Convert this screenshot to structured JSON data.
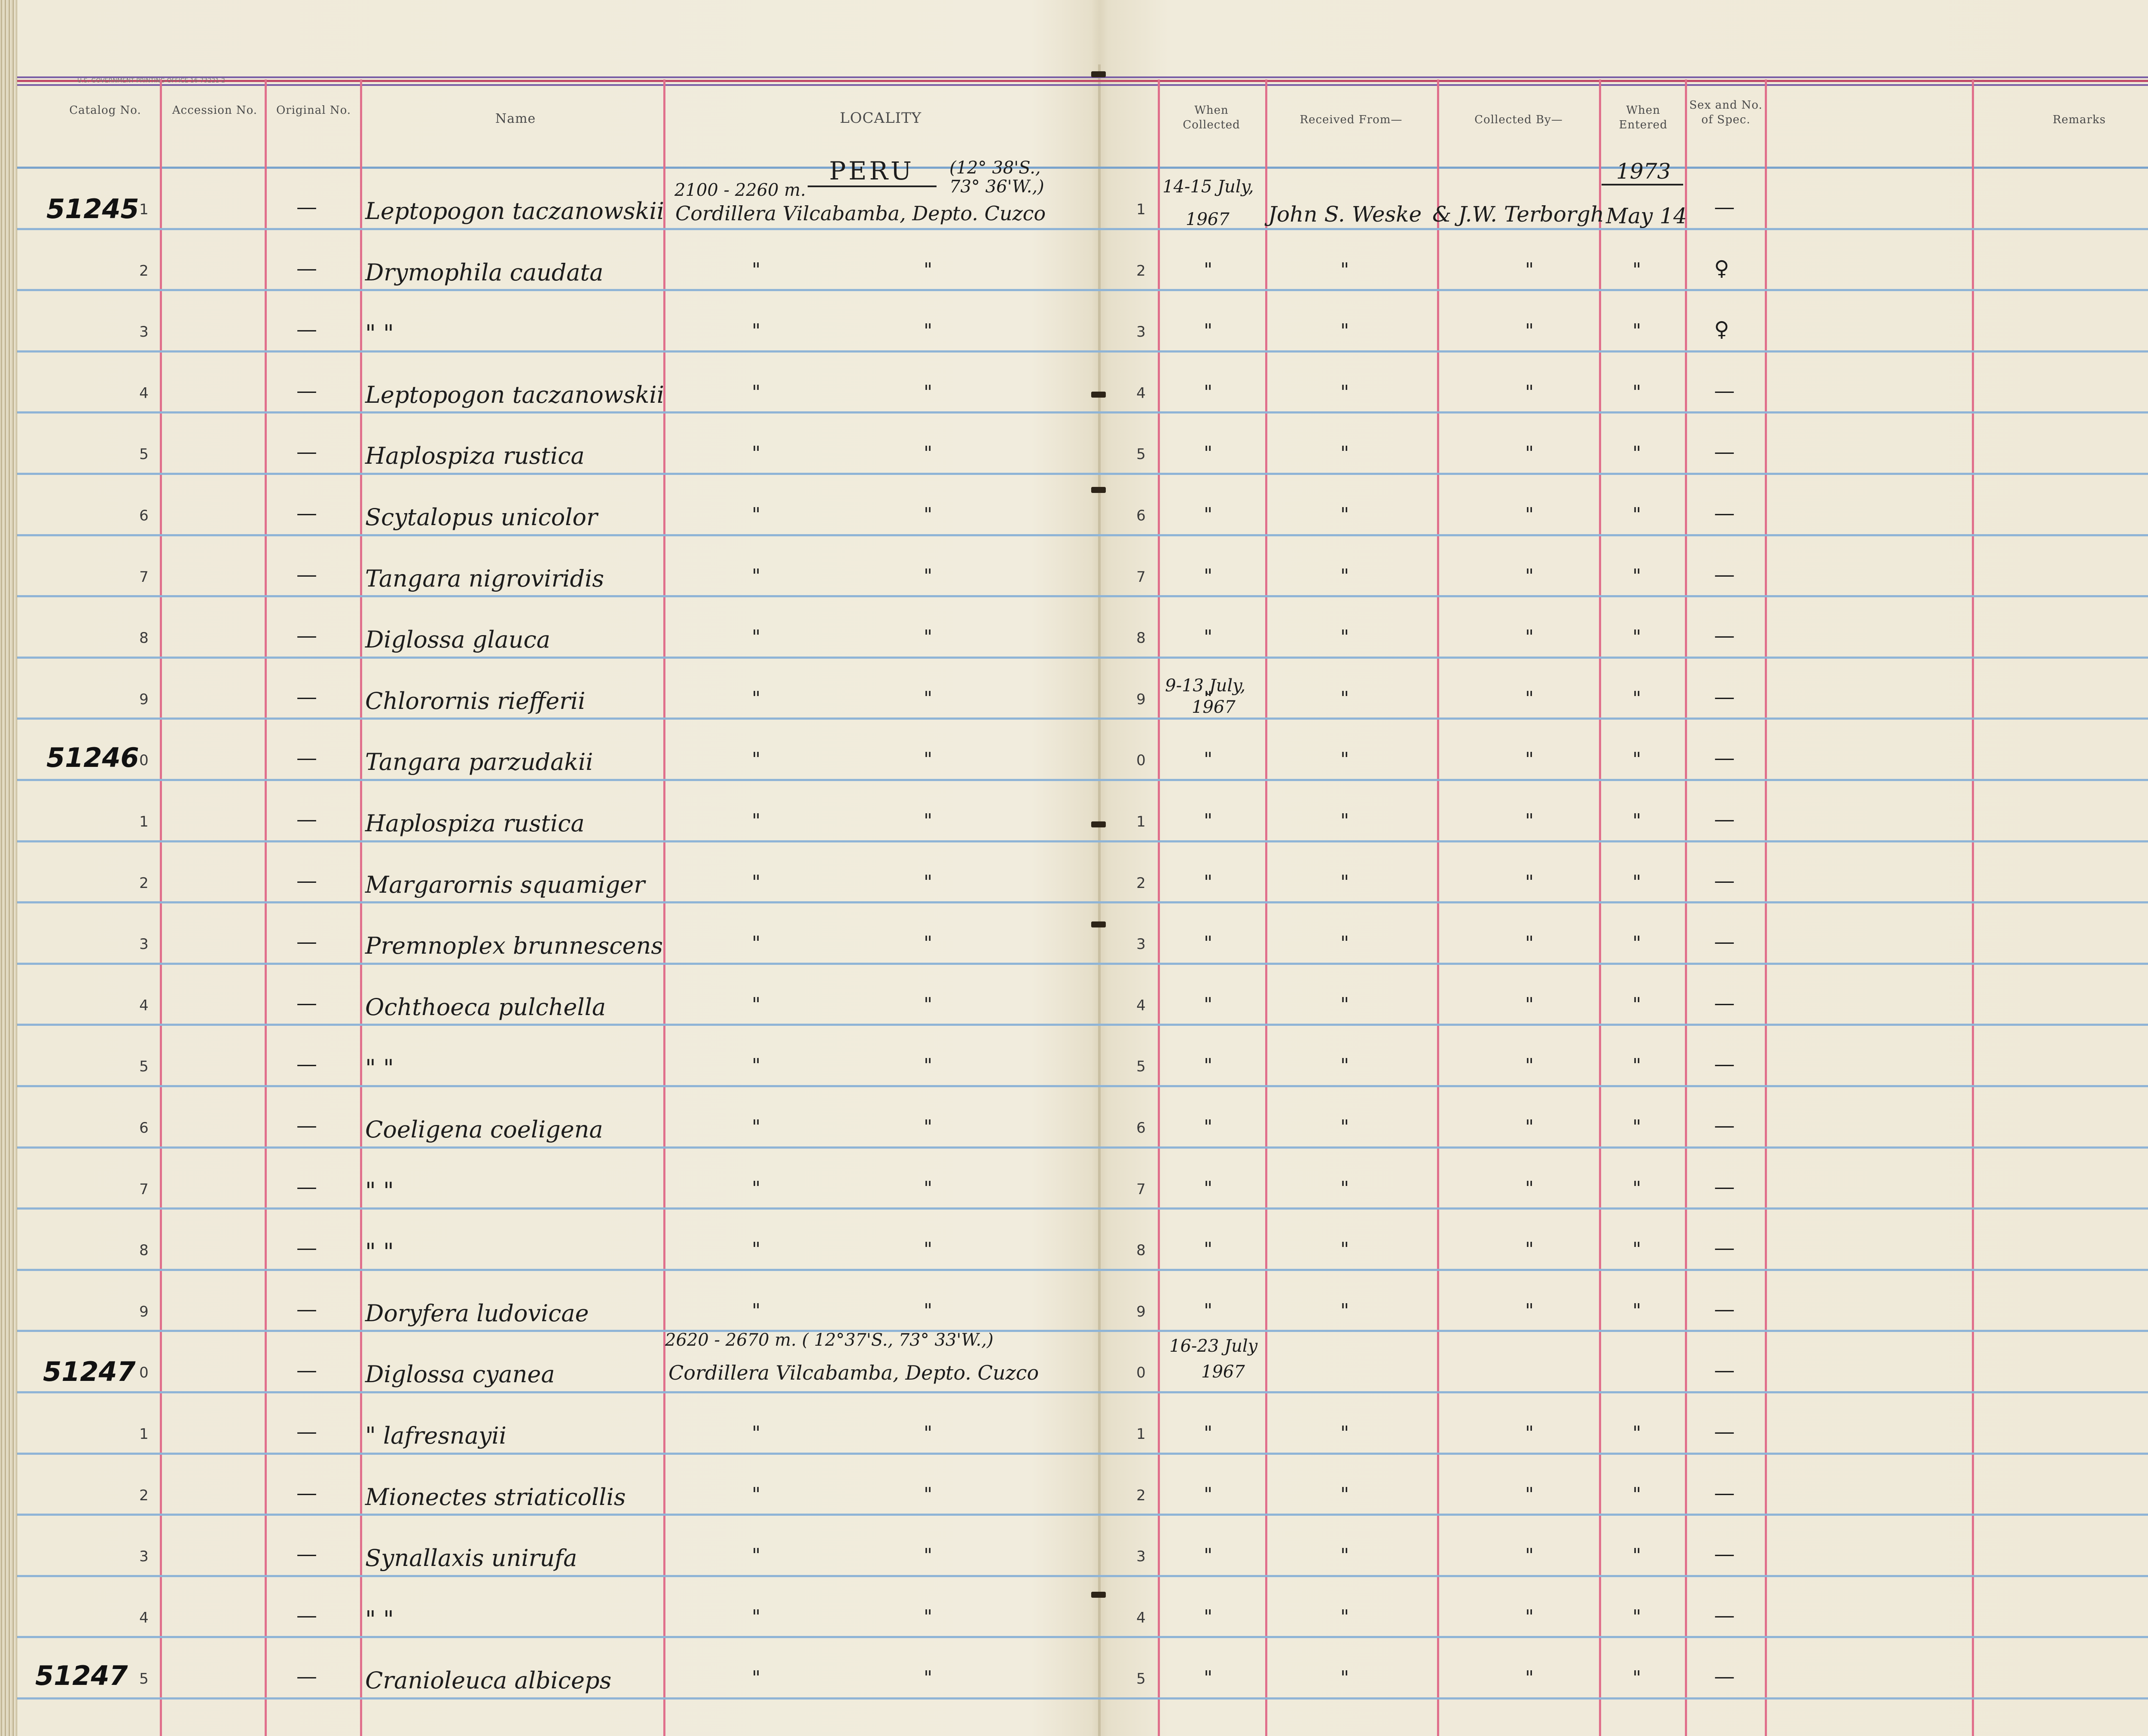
{
  "print_line": "U.S. GOVERNMENT PRINTING OFFICE   16-73221-2",
  "headers": {
    "catalog": "Catalog No.",
    "accession": "Accession No.",
    "original": "Original No.",
    "name": "Name",
    "locality": "LOCALITY",
    "when_collected": "When Collected",
    "received_from": "Received From—",
    "collected_by": "Collected By—",
    "when_entered": "When Entered",
    "sex": "Sex and No. of Spec.",
    "remarks": "Remarks"
  },
  "locality_header": {
    "country": "PERU",
    "elevation_1": "2100 - 2260 m.",
    "coords_1a": "(12° 38'S.,",
    "coords_1b": "73° 36'W.,)",
    "place_1": "Cordillera Vilcabamba, Depto. Cuzco",
    "elevation_2": "2620 - 2670 m. ( 12°37'S., 73° 33'W.,)",
    "place_2": "Cordillera Vilcabamba, Depto. Cuzco"
  },
  "collected": {
    "date_1a": "14-15 July,",
    "date_1b": "1967",
    "date_2a": "9-13 July,",
    "date_2b": "1967",
    "date_3a": "16-23 July",
    "date_3b": "1967"
  },
  "received_from": "John S. Weske",
  "collected_by": "& J.W. Terborgh",
  "entered": {
    "year": "1973",
    "date": "May 14"
  },
  "catalog_marks": {
    "r1": "51245",
    "r10": "51246",
    "r20": "51247",
    "r25": "51247"
  },
  "dash": "—",
  "ditto": "\"",
  "female": "♀",
  "rows": [
    {
      "n": "1",
      "name": "Leptopogon taczanowskii",
      "sex": "—"
    },
    {
      "n": "2",
      "name": "Drymophila caudata",
      "sex": "♀"
    },
    {
      "n": "3",
      "name": "\"        \"",
      "sex": "♀"
    },
    {
      "n": "4",
      "name": "Leptopogon taczanowskii",
      "sex": "—"
    },
    {
      "n": "5",
      "name": "Haplospiza rustica",
      "sex": "—"
    },
    {
      "n": "6",
      "name": "Scytalopus unicolor",
      "sex": "—"
    },
    {
      "n": "7",
      "name": "Tangara nigroviridis",
      "sex": "—"
    },
    {
      "n": "8",
      "name": "Diglossa glauca",
      "sex": "—"
    },
    {
      "n": "9",
      "name": "Chlorornis riefferii",
      "sex": "—"
    },
    {
      "n": "0",
      "name": "Tangara parzudakii",
      "sex": "—"
    },
    {
      "n": "1",
      "name": "Haplospiza rustica",
      "sex": "—"
    },
    {
      "n": "2",
      "name": "Margarornis squamiger",
      "sex": "—"
    },
    {
      "n": "3",
      "name": "Premnoplex brunnescens",
      "sex": "—"
    },
    {
      "n": "4",
      "name": "Ochthoeca pulchella",
      "sex": "—"
    },
    {
      "n": "5",
      "name": "\"        \"",
      "sex": "—"
    },
    {
      "n": "6",
      "name": "Coeligena coeligena",
      "sex": "—"
    },
    {
      "n": "7",
      "name": "\"        \"",
      "sex": "—"
    },
    {
      "n": "8",
      "name": "\"        \"",
      "sex": "—"
    },
    {
      "n": "9",
      "name": "Doryfera ludovicae",
      "sex": "—"
    },
    {
      "n": "0",
      "name": "Diglossa cyanea",
      "sex": "—"
    },
    {
      "n": "1",
      "name": "\"    lafresnayii",
      "sex": "—"
    },
    {
      "n": "2",
      "name": "Mionectes striaticollis",
      "sex": "—"
    },
    {
      "n": "3",
      "name": "Synallaxis unirufa",
      "sex": "—"
    },
    {
      "n": "4",
      "name": "\"        \"",
      "sex": "—"
    },
    {
      "n": "5",
      "name": "Cranioleuca albiceps",
      "sex": "—"
    }
  ]
}
